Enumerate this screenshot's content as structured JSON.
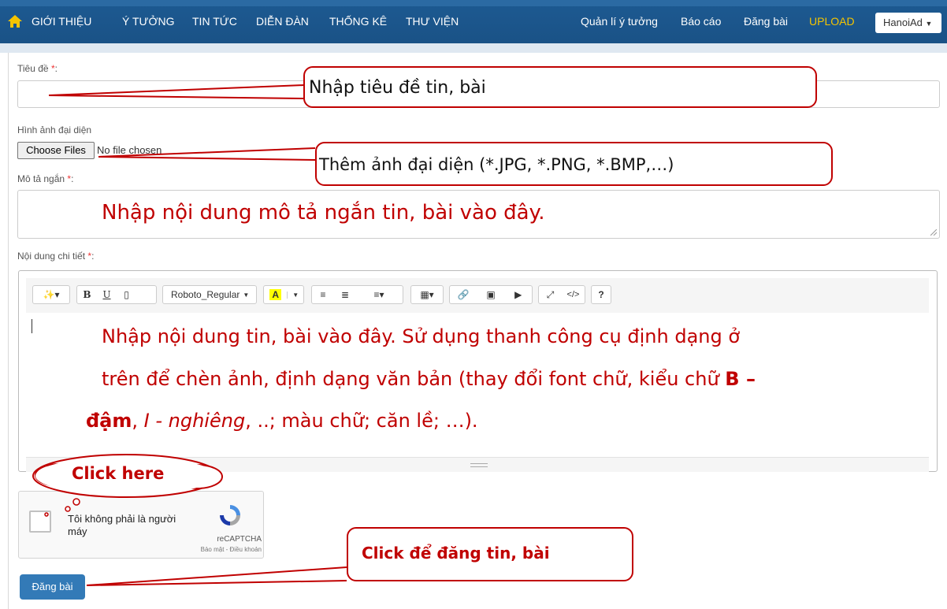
{
  "nav": {
    "items": [
      "GIỚI THIỆU",
      "Ý TƯỞNG",
      "TIN TỨC",
      "DIỄN ĐÀN",
      "THỐNG KÊ",
      "THƯ VIỆN"
    ],
    "right": [
      "Quản lí ý tưởng",
      "Báo cáo",
      "Đăng bài",
      "UPLOAD"
    ],
    "user": "HanoiAd"
  },
  "form": {
    "title_label": "Tiêu đề",
    "image_label": "Hình ảnh đại diện",
    "choose_files": "Choose Files",
    "no_file": "No file chosen",
    "summary_label": "Mô tả ngắn",
    "detail_label": "Nội dung chi tiết",
    "required_mark": "*",
    "colon": ":",
    "font_name": "Roboto_Regular",
    "summary_hint": "Nhập nội dung mô tả ngắn tin, bài vào đây.",
    "body_hint_1": "Nhập nội dung tin, bài vào đây. Sử dụng thanh công cụ định dạng ở",
    "body_hint_2a": "trên để chèn ảnh, định dạng văn bản (thay đổi font chữ, kiểu chữ ",
    "body_hint_2b": "B –",
    "body_hint_3a": "đậm",
    "body_hint_3b": ", ",
    "body_hint_3c": "I - nghiêng",
    "body_hint_3d": ", ..; màu chữ; căn lề; …).",
    "submit": "Đăng bài"
  },
  "recaptcha": {
    "label": "Tôi không phải là người máy",
    "brand": "reCAPTCHA",
    "links": "Bảo mật - Điều khoản"
  },
  "callouts": {
    "title": "Nhập tiêu đề tin, bài",
    "image": "Thêm ảnh đại diện (*.JPG, *.PNG, *.BMP,…)",
    "click_here": "Click here",
    "submit": "Click để đăng tin, bài"
  },
  "colors": {
    "navbar": "#1a5286",
    "accent_yellow": "#f5c400",
    "annotation_red": "#c00000",
    "button": "#337ab7"
  }
}
